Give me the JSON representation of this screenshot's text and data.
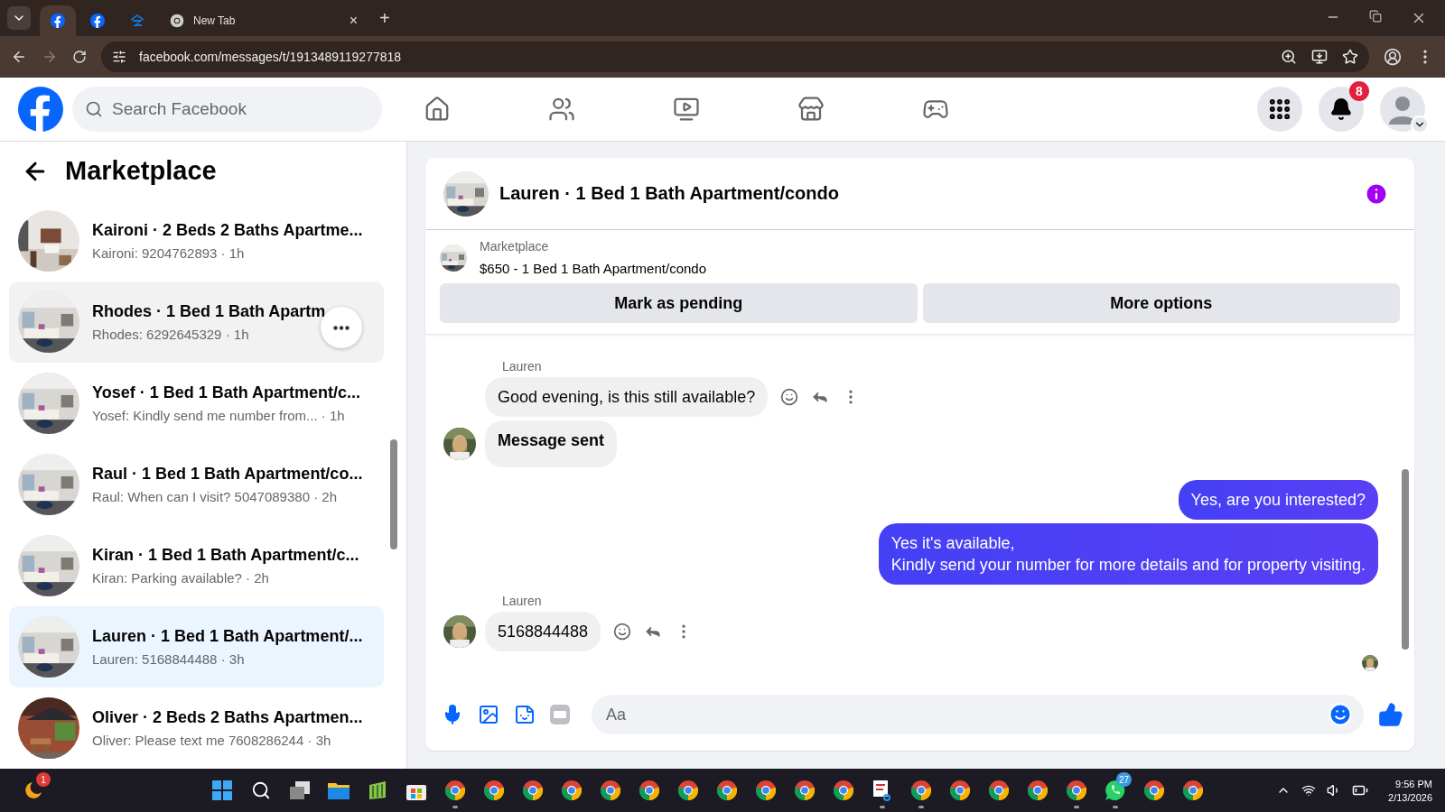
{
  "browser": {
    "tabs": [
      {
        "kind": "facebook",
        "selected": true
      },
      {
        "kind": "facebook",
        "selected": false
      },
      {
        "kind": "zillow",
        "selected": false
      },
      {
        "kind": "chrome",
        "label": "New Tab",
        "selected": false
      }
    ],
    "new_tab": "+",
    "close_tab": "×",
    "url": "facebook.com/messages/t/1913489119277818"
  },
  "header": {
    "search": {
      "placeholder": "Search Facebook"
    },
    "nav": [
      {
        "kind": "home"
      },
      {
        "kind": "friends"
      },
      {
        "kind": "video"
      },
      {
        "kind": "marketplace"
      },
      {
        "kind": "gaming"
      }
    ],
    "notification_count": "8"
  },
  "sidebar": {
    "title": "Marketplace",
    "items": [
      {
        "title": "Kaironi · 2 Beds 2 Baths Apartme...",
        "preview": "Kaironi: 9204762893 · 1h",
        "selected": false,
        "hovered": false
      },
      {
        "title": "Rhodes · 1 Bed 1 Bath Apartm",
        "preview": "Rhodes: 6292645329 · 1h",
        "selected": false,
        "hovered": true
      },
      {
        "title": "Yosef · 1 Bed 1 Bath Apartment/c...",
        "preview": "Yosef: Kindly send me number from... · 1h",
        "selected": false,
        "hovered": false
      },
      {
        "title": "Raul · 1 Bed 1 Bath Apartment/co...",
        "preview": "Raul: When can I visit? 5047089380 · 2h",
        "selected": false,
        "hovered": false
      },
      {
        "title": "Kiran · 1 Bed 1 Bath Apartment/c...",
        "preview": "Kiran: Parking available? · 2h",
        "selected": false,
        "hovered": false
      },
      {
        "title": "Lauren · 1 Bed 1 Bath Apartment/...",
        "preview": "Lauren: 5168844488 · 3h",
        "selected": true,
        "hovered": false
      },
      {
        "title": "Oliver · 2 Beds 2 Baths Apartmen...",
        "preview": "Oliver: Please text me 7608286244 · 3h",
        "selected": false,
        "hovered": false
      }
    ]
  },
  "chat": {
    "title": "Lauren · 1 Bed 1 Bath Apartment/condo",
    "listing": {
      "source": "Marketplace",
      "name": "$650 - 1 Bed 1 Bath Apartment/condo"
    },
    "actions": [
      "Mark as pending",
      "More options"
    ],
    "messages": [
      {
        "kind": "incoming",
        "sender": "Lauren",
        "text": "Good evening, is this still available?",
        "bold": false
      },
      {
        "kind": "incoming",
        "text": "Message sent",
        "bold": true
      },
      {
        "kind": "outgoing",
        "text": "Yes, are you interested?"
      },
      {
        "kind": "outgoing",
        "text": "Yes it's available,\nKindly send your number for more details and for property visiting."
      },
      {
        "kind": "incoming",
        "sender": "Lauren",
        "text": "5168844488",
        "bold": false
      }
    ],
    "composer": {
      "placeholder": "Aa"
    }
  },
  "taskbar": {
    "weather_badge": "1",
    "apps": [
      {
        "kind": "start",
        "running": false
      },
      {
        "kind": "search",
        "running": false
      },
      {
        "kind": "taskview",
        "running": false
      },
      {
        "kind": "folder",
        "running": false
      },
      {
        "kind": "sheets",
        "running": false
      },
      {
        "kind": "store",
        "running": false
      },
      {
        "kind": "chrome",
        "running": true
      },
      {
        "kind": "chrome",
        "running": false
      },
      {
        "kind": "chrome",
        "running": false
      },
      {
        "kind": "chrome",
        "running": false
      },
      {
        "kind": "chrome",
        "running": false
      },
      {
        "kind": "chrome",
        "running": false
      },
      {
        "kind": "chrome",
        "running": false
      },
      {
        "kind": "chrome",
        "running": false
      },
      {
        "kind": "chrome",
        "running": false
      },
      {
        "kind": "chrome",
        "running": false
      },
      {
        "kind": "chrome",
        "running": false
      },
      {
        "kind": "snip",
        "running": true
      },
      {
        "kind": "chrome",
        "running": true
      },
      {
        "kind": "chrome",
        "running": false
      },
      {
        "kind": "chrome",
        "running": false
      },
      {
        "kind": "chrome",
        "running": false
      },
      {
        "kind": "chrome",
        "running": true
      },
      {
        "kind": "whatsapp",
        "badge": "27",
        "running": true
      },
      {
        "kind": "chrome",
        "running": false
      },
      {
        "kind": "chrome",
        "running": false
      }
    ],
    "time": "9:56 PM",
    "date": "2/13/2026"
  }
}
